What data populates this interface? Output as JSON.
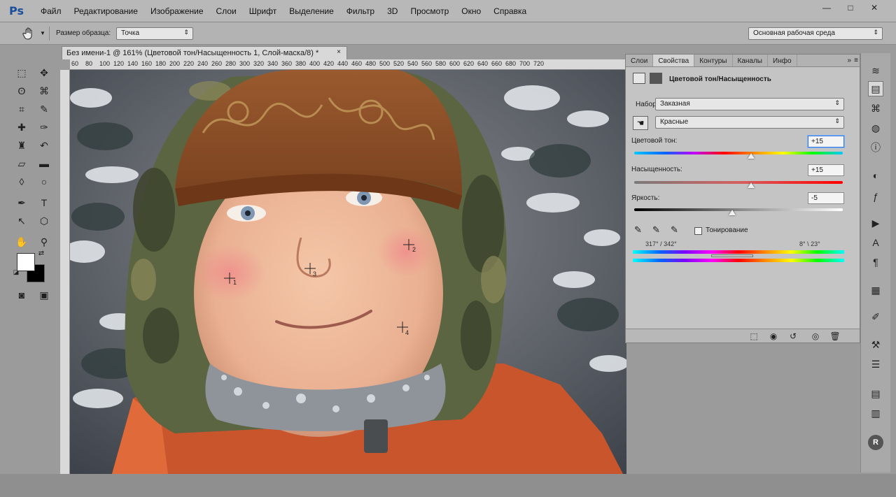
{
  "app": {
    "logo": "Ps"
  },
  "menu": [
    "Файл",
    "Редактирование",
    "Изображение",
    "Слои",
    "Шрифт",
    "Выделение",
    "Фильтр",
    "3D",
    "Просмотр",
    "Окно",
    "Справка"
  ],
  "window_controls": {
    "minimize": "—",
    "maximize": "□",
    "close": "✕"
  },
  "options": {
    "sample_size_label": "Размер образца:",
    "sample_size_value": "Точка",
    "workspace": "Основная рабочая среда"
  },
  "document": {
    "tab_title": "Без имени-1 @ 161% (Цветовой тон/Насыщенность 1, Слой-маска/8) *",
    "close": "×",
    "ruler_ticks": [
      "60",
      "80",
      "100",
      "120",
      "140",
      "160",
      "180",
      "200",
      "220",
      "240",
      "260",
      "280",
      "300",
      "320",
      "340",
      "360",
      "380",
      "400",
      "420",
      "440",
      "460",
      "480",
      "500",
      "520",
      "540",
      "560",
      "580",
      "600",
      "620",
      "640",
      "660",
      "680",
      "700",
      "720"
    ]
  },
  "panel": {
    "tabs": [
      "Слои",
      "Свойства",
      "Контуры",
      "Каналы",
      "Инфо"
    ],
    "active_tab_index": 1,
    "more": "»",
    "menu": "≡",
    "title": "Цветовой тон/Насыщенность",
    "preset_label": "Набор:",
    "preset_value": "Заказная",
    "channel_value": "Красные",
    "hue_label": "Цветовой тон:",
    "hue_value": "+15",
    "saturation_label": "Насыщенность:",
    "saturation_value": "+15",
    "lightness_label": "Яркость:",
    "lightness_value": "-5",
    "colorize_label": "Тонирование",
    "range_left": "317° / 342°",
    "range_right": "8° \\ 23°"
  },
  "sliders": {
    "hue": 0.56,
    "saturation": 0.56,
    "lightness": 0.47
  },
  "sample_points": [
    "1",
    "2",
    "3",
    "4"
  ],
  "colors": {
    "accent": "#3a7ad8",
    "panel_bg": "#c4c4c4",
    "menubar": "#b8b8b8"
  }
}
